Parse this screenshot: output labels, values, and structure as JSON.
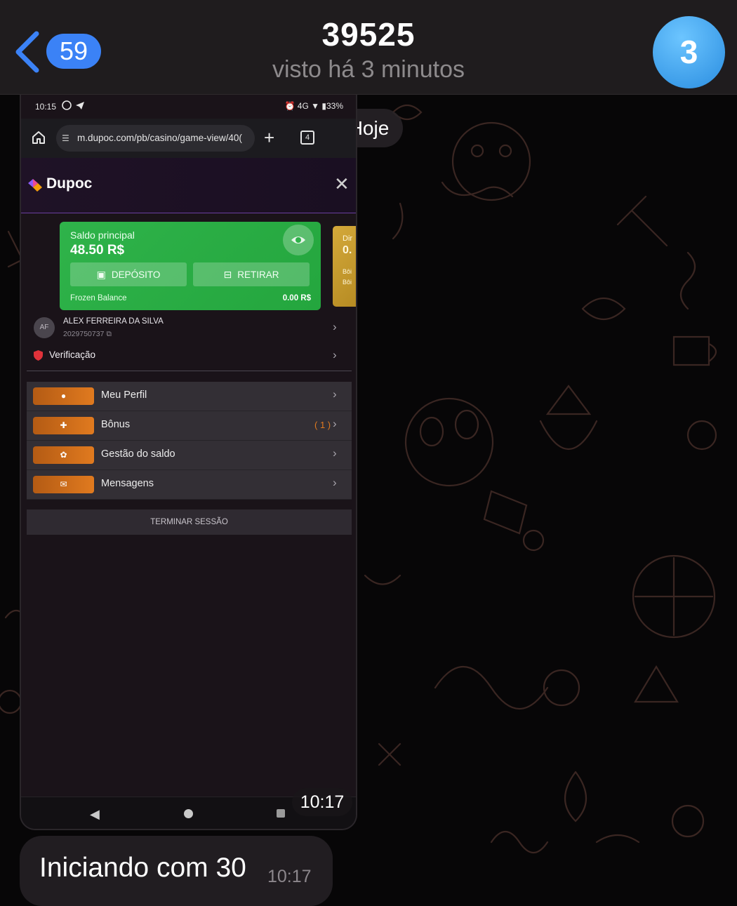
{
  "header": {
    "back_badge": "59",
    "title": "39525",
    "status": "visto há 3 minutos",
    "avatar_initial": "3"
  },
  "date_separator": "Hoje",
  "photo": {
    "time": "10:17",
    "phone": {
      "status_time": "10:15",
      "status_icons": "WhatsApp, Telegram",
      "battery": "33%",
      "signal_label": "4G",
      "url": "m.dupoc.com/pb/casino/game-view/40(",
      "tab_count": "4",
      "site_logo": "Dupoc",
      "balance": {
        "label": "Saldo principal",
        "amount": "48.50 R$",
        "deposit_label": "DEPÓSITO",
        "withdraw_label": "RETIRAR",
        "frozen_label": "Frozen Balance",
        "frozen_value": "0.00 R$"
      },
      "side_card": {
        "line1": "Dir",
        "line2": "0.",
        "line3": "Bôi",
        "line4": "Bôi"
      },
      "user": {
        "initials": "AF",
        "name": "ALEX FERREIRA DA SILVA",
        "id": "2029750737"
      },
      "verification_label": "Verificação",
      "menu": [
        {
          "label": "Meu Perfil",
          "icon": "user-icon",
          "glyph": "●"
        },
        {
          "label": "Bônus",
          "icon": "gift-icon",
          "glyph": "✚",
          "count": "( 1 )"
        },
        {
          "label": "Gestão do saldo",
          "icon": "settings-icon",
          "glyph": "✿"
        },
        {
          "label": "Mensagens",
          "icon": "mail-icon",
          "glyph": "✉"
        }
      ],
      "logout_label": "TERMINAR SESSÃO"
    }
  },
  "message": {
    "text": "Iniciando com 30",
    "time": "10:17"
  },
  "colors": {
    "telegram_blue": "#3b82f6",
    "balance_green": "#2fb34a",
    "menu_orange": "#e07a1f"
  }
}
